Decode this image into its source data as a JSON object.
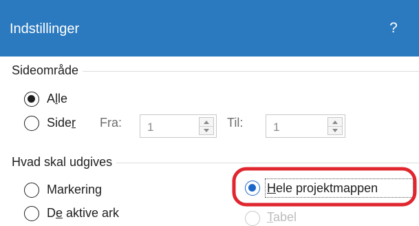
{
  "dialog": {
    "title": "Indstillinger",
    "help": "?"
  },
  "page_range": {
    "label": "Sideområde",
    "all": {
      "pre": "A",
      "ul": "l",
      "post": "le",
      "checked": true
    },
    "pages": {
      "pre": "Side",
      "ul": "r",
      "post": "",
      "checked": false
    },
    "from_label": "Fra:",
    "from_value": "1",
    "to_label": "Til:",
    "to_value": "1"
  },
  "publish": {
    "label": "Hvad skal udgives",
    "selection": {
      "pre": "Markerin",
      "ul": "g",
      "post": "",
      "checked": false
    },
    "active_sheets": {
      "pre": "D",
      "ul": "e",
      "post": " aktive ark",
      "checked": false
    },
    "whole_workbook": {
      "pre": "",
      "ul": "H",
      "post": "ele projektmappen",
      "checked": true
    },
    "table": {
      "pre": "",
      "ul": "T",
      "post": "abel",
      "checked": false
    }
  },
  "colors": {
    "title_bar": "#2b79bf",
    "highlight": "#e0262f",
    "radio_selected": "#1a66c9"
  }
}
